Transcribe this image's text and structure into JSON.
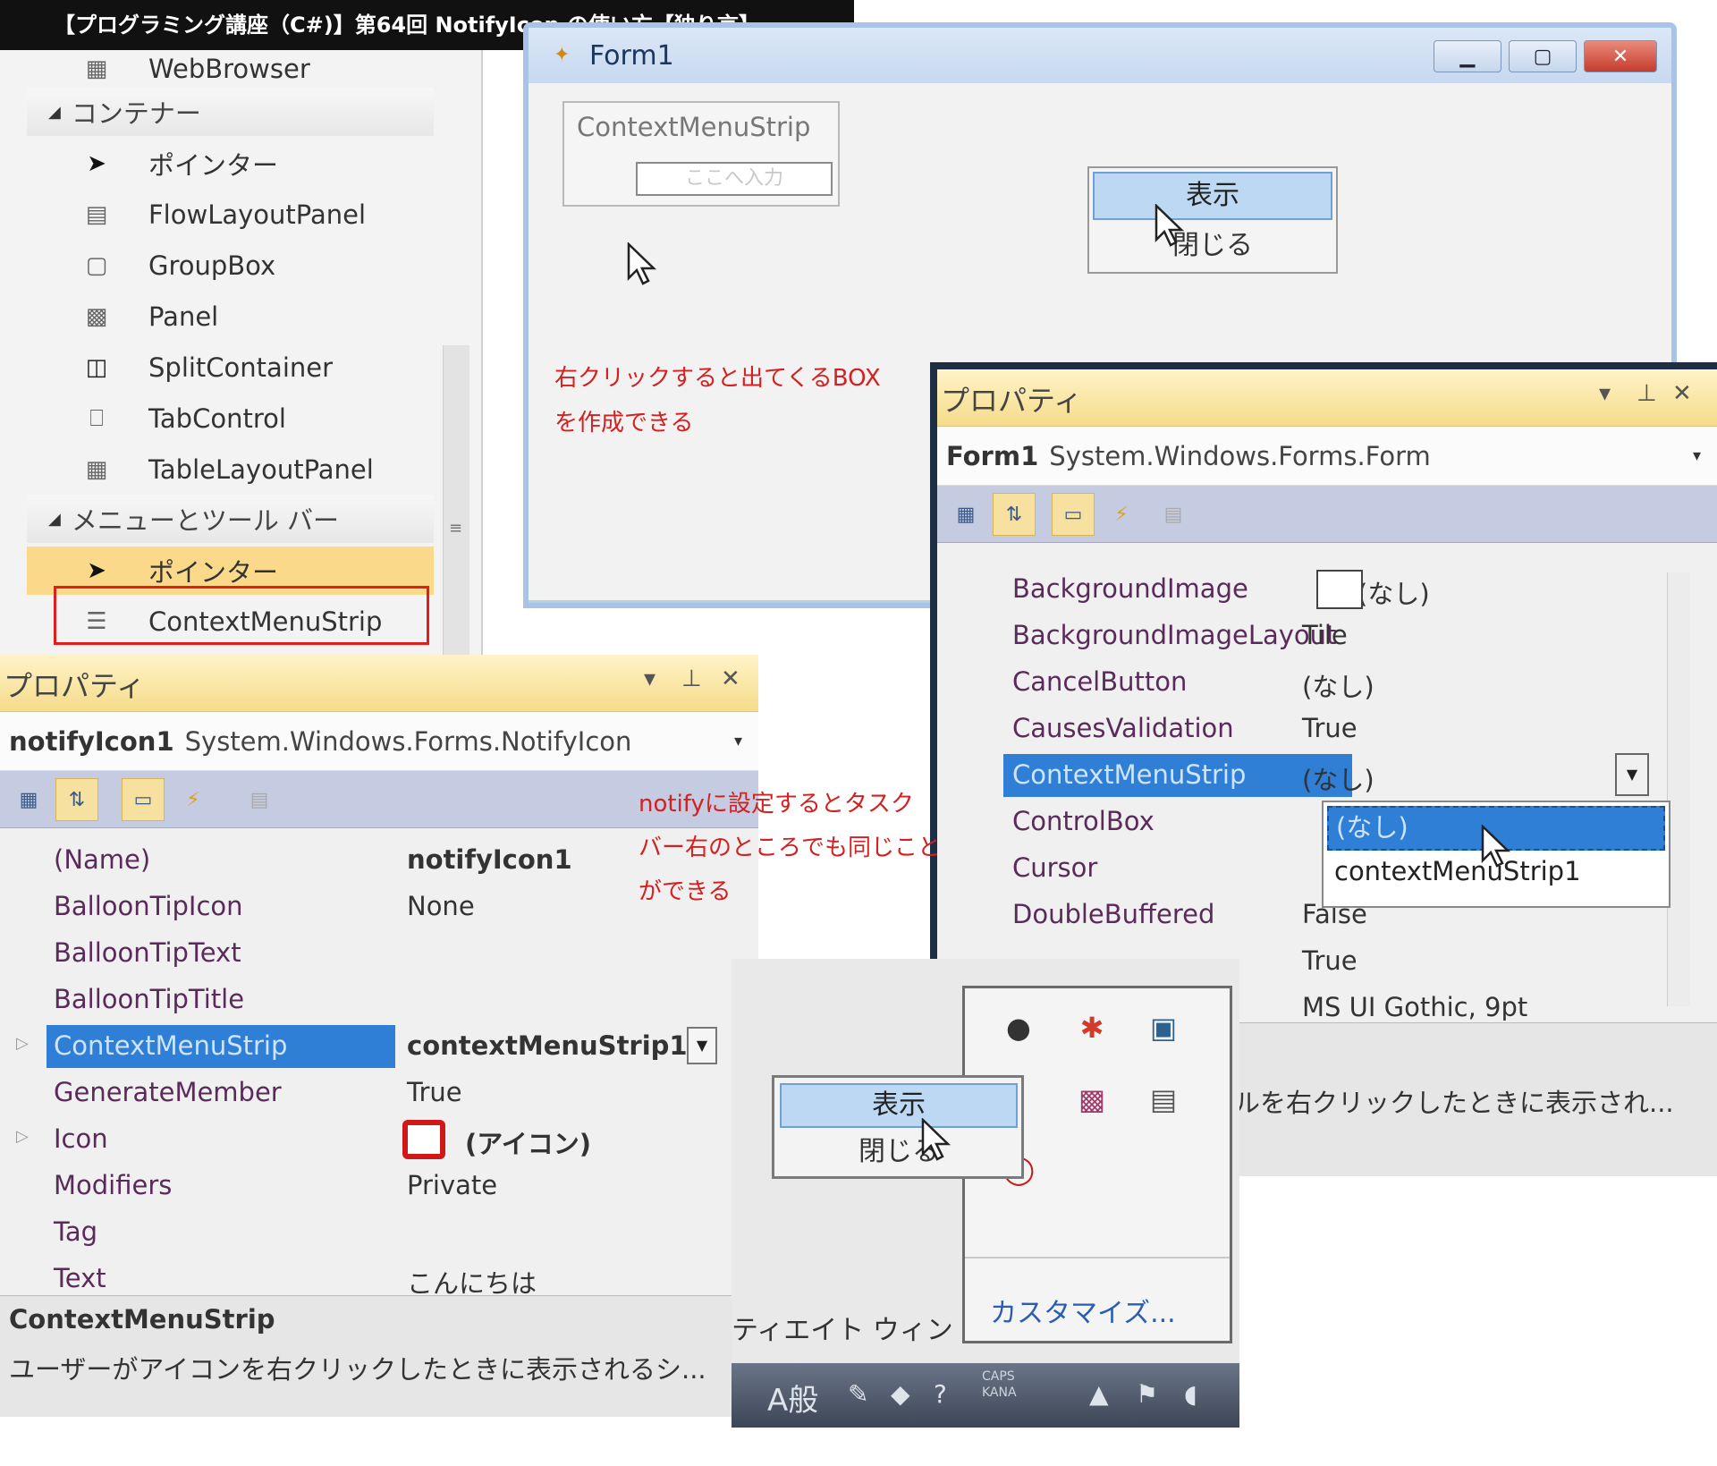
{
  "banner": {
    "title": "【プログラミング講座（C#)】第64回 NotifyIcon の使い方【独り言】"
  },
  "toolbox": {
    "items": [
      {
        "label": "WebBrowser",
        "icon": "webbrowser-icon",
        "kind": "item"
      },
      {
        "label": "コンテナー",
        "icon": "expand-triangle-icon",
        "kind": "category"
      },
      {
        "label": "ポインター",
        "icon": "pointer-arrow-icon",
        "kind": "item"
      },
      {
        "label": "FlowLayoutPanel",
        "icon": "flowlayoutpanel-icon",
        "kind": "item"
      },
      {
        "label": "GroupBox",
        "icon": "groupbox-icon",
        "kind": "item"
      },
      {
        "label": "Panel",
        "icon": "panel-icon",
        "kind": "item"
      },
      {
        "label": "SplitContainer",
        "icon": "splitcontainer-icon",
        "kind": "item"
      },
      {
        "label": "TabControl",
        "icon": "tabcontrol-icon",
        "kind": "item"
      },
      {
        "label": "TableLayoutPanel",
        "icon": "tablelayoutpanel-icon",
        "kind": "item"
      },
      {
        "label": "メニューとツール バー",
        "icon": "expand-triangle-icon",
        "kind": "category"
      },
      {
        "label": "ポインター",
        "icon": "pointer-arrow-icon",
        "kind": "selected"
      },
      {
        "label": "ContextMenuStrip",
        "icon": "contextmenustrip-icon",
        "kind": "item"
      }
    ],
    "highlight_color": "#e01e1e"
  },
  "form1": {
    "caption": "Form1",
    "strip_label": "ContextMenuStrip",
    "strip_placeholder": "ここへ入力",
    "menu_show": "表示",
    "menu_close": "閉じる",
    "note_line1": "右クリックすると出てくるBOX",
    "note_line2": "を作成できる",
    "note_color": "#d42020"
  },
  "note2": {
    "line1": "notifyに設定するとタスク",
    "line2": "バー右のところでも同じこと",
    "line3": "ができる"
  },
  "prop_form": {
    "header": "プロパティ",
    "object_name": "Form1",
    "object_class": "System.Windows.Forms.Form",
    "rows": [
      {
        "name": "BackgroundImage",
        "value": "(なし)"
      },
      {
        "name": "BackgroundImageLayout",
        "value": "Tile"
      },
      {
        "name": "CancelButton",
        "value": "(なし)"
      },
      {
        "name": "CausesValidation",
        "value": "True"
      },
      {
        "name": "ContextMenuStrip",
        "value": "(なし)"
      },
      {
        "name": "ControlBox",
        "value": ""
      },
      {
        "name": "Cursor",
        "value": ""
      },
      {
        "name": "DoubleBuffered",
        "value": "False"
      },
      {
        "name": "",
        "value": "True"
      },
      {
        "name": "",
        "value": "MS UI Gothic, 9pt"
      }
    ],
    "dropdown_options": [
      "(なし)",
      "contextMenuStrip1"
    ],
    "description_fragment": "ルを右クリックしたときに表示され..."
  },
  "prop_notify": {
    "header": "プロパティ",
    "object_name": "notifyIcon1",
    "object_class": "System.Windows.Forms.NotifyIcon",
    "rows": [
      {
        "name": "(Name)",
        "value": "notifyIcon1"
      },
      {
        "name": "BalloonTipIcon",
        "value": "None"
      },
      {
        "name": "BalloonTipText",
        "value": ""
      },
      {
        "name": "BalloonTipTitle",
        "value": ""
      },
      {
        "name": "ContextMenuStrip",
        "value": "contextMenuStrip1"
      },
      {
        "name": "GenerateMember",
        "value": "True"
      },
      {
        "name": "Icon",
        "value": "(アイコン)"
      },
      {
        "name": "Modifiers",
        "value": "Private"
      },
      {
        "name": "Tag",
        "value": ""
      },
      {
        "name": "Text",
        "value": "こんにちは"
      }
    ],
    "description_title": "ContextMenuStrip",
    "description_text": "ユーザーがアイコンを右クリックしたときに表示されるシ..."
  },
  "tray": {
    "menu_show": "表示",
    "menu_close": "閉じる",
    "customize": "カスタマイズ...",
    "label_fragment": "ティエイト ウィン",
    "ime_text": "A般",
    "caps_line1": "CAPS",
    "caps_line2": "KANA"
  }
}
